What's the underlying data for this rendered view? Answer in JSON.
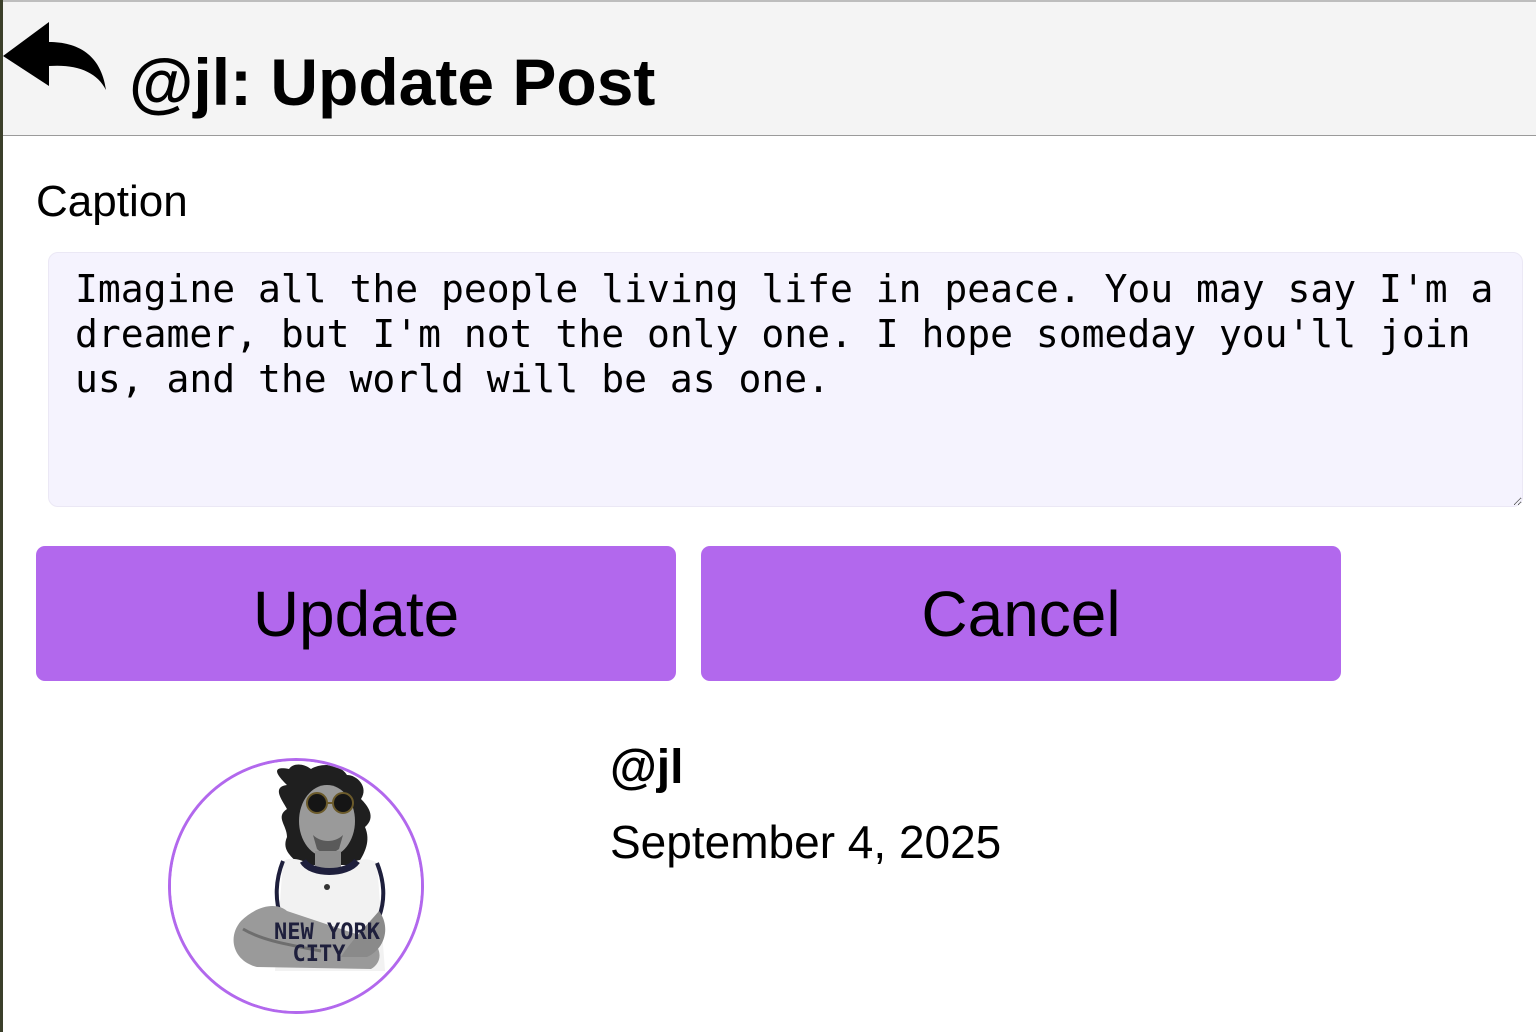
{
  "header": {
    "title": "@jl: Update Post",
    "back_icon": "back-arrow-icon"
  },
  "form": {
    "caption_label": "Caption",
    "caption_value": "Imagine all the people living life in peace. You may say I'm a dreamer, but I'm not the only one. I hope someday you'll join us, and the world will be as one.",
    "update_label": "Update",
    "cancel_label": "Cancel"
  },
  "post": {
    "username": "@jl",
    "date": "September 4, 2025",
    "avatar_shirt_text": [
      "NEW YORK",
      "CITY"
    ]
  },
  "colors": {
    "accent": "#b268ed",
    "textarea_bg": "#f5f3fe",
    "header_bg": "#f4f4f4"
  }
}
